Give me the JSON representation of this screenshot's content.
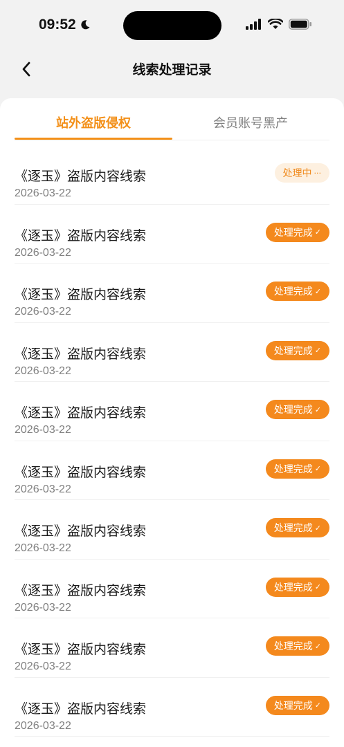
{
  "status_bar": {
    "time": "09:52"
  },
  "header": {
    "title": "线索处理记录"
  },
  "tabs": [
    {
      "label": "站外盗版侵权",
      "active": true
    },
    {
      "label": "会员账号黑产",
      "active": false
    }
  ],
  "colors": {
    "accent": "#f39019",
    "badge_pending_bg": "#fdf0e0"
  },
  "records": [
    {
      "title": "《逐玉》盗版内容线索",
      "date": "2026-03-22",
      "status": "处理中",
      "status_icon": "···"
    },
    {
      "title": "《逐玉》盗版内容线索",
      "date": "2026-03-22",
      "status": "处理完成",
      "status_icon": "✓"
    },
    {
      "title": "《逐玉》盗版内容线索",
      "date": "2026-03-22",
      "status": "处理完成",
      "status_icon": "✓"
    },
    {
      "title": "《逐玉》盗版内容线索",
      "date": "2026-03-22",
      "status": "处理完成",
      "status_icon": "✓"
    },
    {
      "title": "《逐玉》盗版内容线索",
      "date": "2026-03-22",
      "status": "处理完成",
      "status_icon": "✓"
    },
    {
      "title": "《逐玉》盗版内容线索",
      "date": "2026-03-22",
      "status": "处理完成",
      "status_icon": "✓"
    },
    {
      "title": "《逐玉》盗版内容线索",
      "date": "2026-03-22",
      "status": "处理完成",
      "status_icon": "✓"
    },
    {
      "title": "《逐玉》盗版内容线索",
      "date": "2026-03-22",
      "status": "处理完成",
      "status_icon": "✓"
    },
    {
      "title": "《逐玉》盗版内容线索",
      "date": "2026-03-22",
      "status": "处理完成",
      "status_icon": "✓"
    },
    {
      "title": "《逐玉》盗版内容线索",
      "date": "2026-03-22",
      "status": "处理完成",
      "status_icon": "✓"
    }
  ]
}
